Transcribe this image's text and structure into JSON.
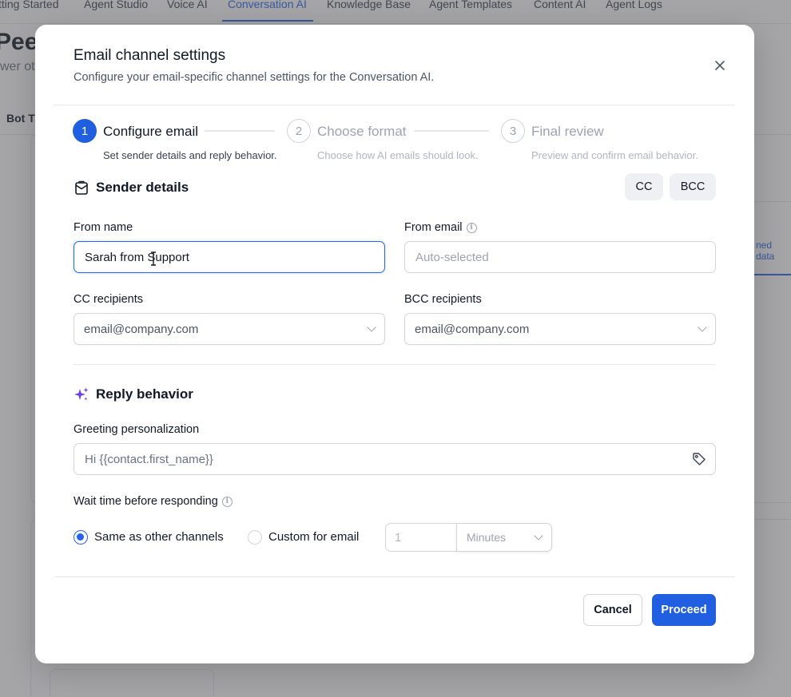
{
  "background": {
    "nav": [
      "tting Started",
      "Agent Studio",
      "Voice AI",
      "Conversation AI",
      "Knowledge Base",
      "Agent Templates",
      "Content AI",
      "Agent Logs"
    ],
    "active_nav": "Conversation AI",
    "page_title": "Peel",
    "page_subtitle": "wer ot",
    "tab_label": "Bot Tr",
    "side_link": "ned data"
  },
  "modal": {
    "title": "Email channel settings",
    "description": "Configure your email-specific channel settings for the Conversation AI.",
    "close_icon": "close-icon"
  },
  "steps": [
    {
      "number": "1",
      "label": "Configure email",
      "description": "Set sender details and reply behavior.",
      "state": "active"
    },
    {
      "number": "2",
      "label": "Choose format",
      "description": "Choose how AI emails should look.",
      "state": "inactive"
    },
    {
      "number": "3",
      "label": "Final review",
      "description": "Preview and confirm email behavior.",
      "state": "inactive"
    }
  ],
  "sender": {
    "title": "Sender details",
    "icon": "mailbox-icon",
    "cc_button": "CC",
    "bcc_button": "BCC",
    "from_name_label": "From name",
    "from_name_value": "Sarah from Support",
    "from_email_label": "From email",
    "from_email_placeholder": "Auto-selected",
    "cc_label": "CC recipients",
    "cc_value": "email@company.com",
    "bcc_label": "BCC recipients",
    "bcc_value": "email@company.com"
  },
  "reply": {
    "title": "Reply behavior",
    "icon": "sparkles-icon",
    "greeting_label": "Greeting personalization",
    "greeting_value": "Hi {{contact.first_name}}",
    "wait_label": "Wait time before responding",
    "option_same": "Same as other channels",
    "option_custom": "Custom for email",
    "selected_option": "same",
    "custom_value_placeholder": "1",
    "unit": "Minutes"
  },
  "footer": {
    "cancel": "Cancel",
    "proceed": "Proceed"
  },
  "colors": {
    "accent": "#1f5fe0",
    "sparkle": "#6d3cf2"
  }
}
